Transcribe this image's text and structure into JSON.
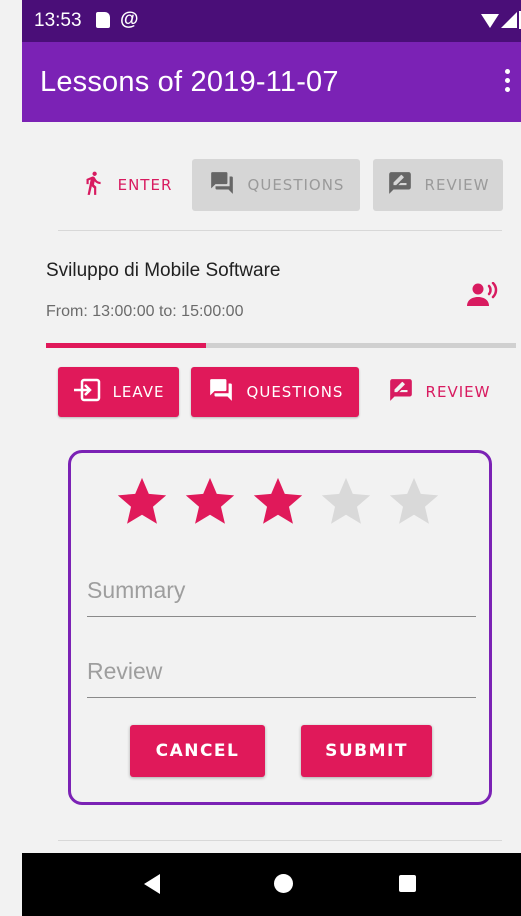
{
  "status_bar": {
    "time": "13:53",
    "icons": [
      "sd-card-icon",
      "at-sign-icon",
      "wifi-icon",
      "signal-icon",
      "battery-icon"
    ]
  },
  "app_bar": {
    "title": "Lessons of 2019-11-07",
    "menu_icon": "more-vert-icon"
  },
  "previous_lesson_actions": {
    "enter_label": "ENTER",
    "questions_label": "QUESTIONS",
    "review_label": "REVIEW"
  },
  "lesson": {
    "title": "Sviluppo di Mobile Software",
    "time": "From: 13:00:00 to: 15:00:00",
    "progress_fraction": 0.34,
    "actions": {
      "leave_label": "LEAVE",
      "questions_label": "QUESTIONS",
      "review_label": "REVIEW"
    }
  },
  "review_form": {
    "rating": 3,
    "max_rating": 5,
    "summary_placeholder": "Summary",
    "review_placeholder": "Review",
    "cancel_label": "CANCEL",
    "submit_label": "SUBMIT"
  },
  "colors": {
    "status_bar": "#4a0e78",
    "app_bar": "#7b22b5",
    "accent": "#e0195a",
    "star_inactive": "#d9d9d9"
  }
}
